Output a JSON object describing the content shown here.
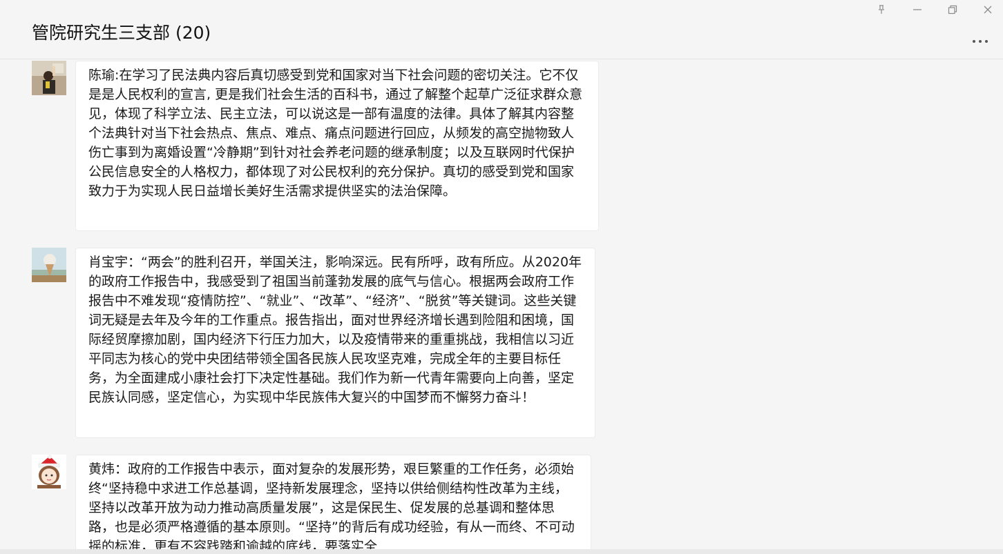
{
  "window": {
    "chat_title": "管院研究生三支部 (20)"
  },
  "icons": {
    "pin": "pin-icon",
    "minimize": "minimize-icon",
    "restore": "restore-icon",
    "close": "close-icon",
    "more": "more-icon"
  },
  "messages": [
    {
      "text": "陈瑜:在学习了民法典内容后真切感受到党和国家对当下社会问题的密切关注。它不仅是是人民权利的宣言, 更是我们社会生活的百科书，通过了解整个起草广泛征求群众意见，体现了科学立法、民主立法，可以说这是一部有温度的法律。具体了解其内容整个法典针对当下社会热点、焦点、难点、痛点问题进行回应，从频发的高空抛物致人伤亡事到为离婚设置“冷静期”到针对社会养老问题的继承制度；以及互联网时代保护公民信息安全的人格权力，都体现了对公民权利的充分保护。真切的感受到党和国家致力于为实现人民日益增长美好生活需求提供坚实的法治保障。"
    },
    {
      "text": "肖宝宇：“两会”的胜利召开，举国关注，影响深远。民有所呼，政有所应。从2020年的政府工作报告中，我感受到了祖国当前蓬勃发展的底气与信心。根据两会政府工作报告中不难发现“疫情防控”、“就业”、“改革”、“经济”、“脱贫”等关键词。这些关键词无疑是去年及今年的工作重点。报告指出，面对世界经济增长遇到险阻和困境，国际经贸摩擦加剧，国内经济下行压力加大，以及疫情带来的重重挑战，我相信以习近平同志为核心的党中央团结带领全国各民族人民攻坚克难，完成全年的主要目标任务，为全面建成小康社会打下决定性基础。我们作为新一代青年需要向上向善，坚定民族认同感，坚定信心，为实现中华民族伟大复兴的中国梦而不懈努力奋斗！"
    },
    {
      "text": "黄炜：政府的工作报告中表示，面对复杂的发展形势，艰巨繁重的工作任务，必须始终“坚持稳中求进工作总基调，坚持新发展理念，坚持以供给侧结构性改革为主线，坚持以改革开放为动力推动高质量发展”，这是保民生、促发展的总基调和整体思路，也是必须严格遵循的基本原则。“坚持”的背后有成功经验，有从一而终、不可动摇的标准，更有不容践踏和逾越的底线，要落实全"
    }
  ]
}
